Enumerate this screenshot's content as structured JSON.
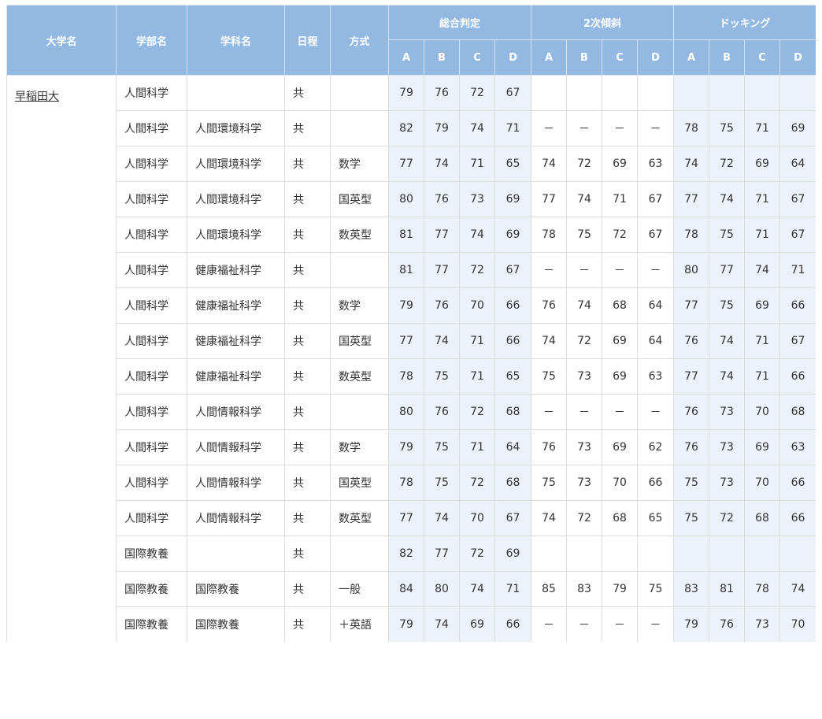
{
  "table": {
    "headers": {
      "university": "大学名",
      "faculty": "学部名",
      "department": "学科名",
      "schedule": "日程",
      "method": "方式",
      "groups": [
        "総合判定",
        "2次傾斜",
        "ドッキング"
      ],
      "grades": [
        "A",
        "B",
        "C",
        "D"
      ]
    },
    "university_name": "早稲田大",
    "rows": [
      {
        "faculty": "人間科学",
        "department": "",
        "schedule": "共",
        "method": "",
        "sogo": [
          "79",
          "76",
          "72",
          "67"
        ],
        "niji": [
          "",
          "",
          "",
          ""
        ],
        "dock": [
          "",
          "",
          "",
          ""
        ]
      },
      {
        "faculty": "人間科学",
        "department": "人間環境科学",
        "schedule": "共",
        "method": "",
        "sogo": [
          "82",
          "79",
          "74",
          "71"
        ],
        "niji": [
          "－",
          "－",
          "－",
          "－"
        ],
        "dock": [
          "78",
          "75",
          "71",
          "69"
        ]
      },
      {
        "faculty": "人間科学",
        "department": "人間環境科学",
        "schedule": "共",
        "method": "数学",
        "sogo": [
          "77",
          "74",
          "71",
          "65"
        ],
        "niji": [
          "74",
          "72",
          "69",
          "63"
        ],
        "dock": [
          "74",
          "72",
          "69",
          "64"
        ]
      },
      {
        "faculty": "人間科学",
        "department": "人間環境科学",
        "schedule": "共",
        "method": "国英型",
        "sogo": [
          "80",
          "76",
          "73",
          "69"
        ],
        "niji": [
          "77",
          "74",
          "71",
          "67"
        ],
        "dock": [
          "77",
          "74",
          "71",
          "67"
        ]
      },
      {
        "faculty": "人間科学",
        "department": "人間環境科学",
        "schedule": "共",
        "method": "数英型",
        "sogo": [
          "81",
          "77",
          "74",
          "69"
        ],
        "niji": [
          "78",
          "75",
          "72",
          "67"
        ],
        "dock": [
          "78",
          "75",
          "71",
          "67"
        ]
      },
      {
        "faculty": "人間科学",
        "department": "健康福祉科学",
        "schedule": "共",
        "method": "",
        "sogo": [
          "81",
          "77",
          "72",
          "67"
        ],
        "niji": [
          "－",
          "－",
          "－",
          "－"
        ],
        "dock": [
          "80",
          "77",
          "74",
          "71"
        ]
      },
      {
        "faculty": "人間科学",
        "department": "健康福祉科学",
        "schedule": "共",
        "method": "数学",
        "sogo": [
          "79",
          "76",
          "70",
          "66"
        ],
        "niji": [
          "76",
          "74",
          "68",
          "64"
        ],
        "dock": [
          "77",
          "75",
          "69",
          "66"
        ]
      },
      {
        "faculty": "人間科学",
        "department": "健康福祉科学",
        "schedule": "共",
        "method": "国英型",
        "sogo": [
          "77",
          "74",
          "71",
          "66"
        ],
        "niji": [
          "74",
          "72",
          "69",
          "64"
        ],
        "dock": [
          "76",
          "74",
          "71",
          "67"
        ]
      },
      {
        "faculty": "人間科学",
        "department": "健康福祉科学",
        "schedule": "共",
        "method": "数英型",
        "sogo": [
          "78",
          "75",
          "71",
          "65"
        ],
        "niji": [
          "75",
          "73",
          "69",
          "63"
        ],
        "dock": [
          "77",
          "74",
          "71",
          "66"
        ]
      },
      {
        "faculty": "人間科学",
        "department": "人間情報科学",
        "schedule": "共",
        "method": "",
        "sogo": [
          "80",
          "76",
          "72",
          "68"
        ],
        "niji": [
          "－",
          "－",
          "－",
          "－"
        ],
        "dock": [
          "76",
          "73",
          "70",
          "68"
        ]
      },
      {
        "faculty": "人間科学",
        "department": "人間情報科学",
        "schedule": "共",
        "method": "数学",
        "sogo": [
          "79",
          "75",
          "71",
          "64"
        ],
        "niji": [
          "76",
          "73",
          "69",
          "62"
        ],
        "dock": [
          "76",
          "73",
          "69",
          "63"
        ]
      },
      {
        "faculty": "人間科学",
        "department": "人間情報科学",
        "schedule": "共",
        "method": "国英型",
        "sogo": [
          "78",
          "75",
          "72",
          "68"
        ],
        "niji": [
          "75",
          "73",
          "70",
          "66"
        ],
        "dock": [
          "75",
          "73",
          "70",
          "66"
        ]
      },
      {
        "faculty": "人間科学",
        "department": "人間情報科学",
        "schedule": "共",
        "method": "数英型",
        "sogo": [
          "77",
          "74",
          "70",
          "67"
        ],
        "niji": [
          "74",
          "72",
          "68",
          "65"
        ],
        "dock": [
          "75",
          "72",
          "68",
          "66"
        ]
      },
      {
        "faculty": "国際教養",
        "department": "",
        "schedule": "共",
        "method": "",
        "sogo": [
          "82",
          "77",
          "72",
          "69"
        ],
        "niji": [
          "",
          "",
          "",
          ""
        ],
        "dock": [
          "",
          "",
          "",
          ""
        ]
      },
      {
        "faculty": "国際教養",
        "department": "国際教養",
        "schedule": "共",
        "method": "一般",
        "sogo": [
          "84",
          "80",
          "74",
          "71"
        ],
        "niji": [
          "85",
          "83",
          "79",
          "75"
        ],
        "dock": [
          "83",
          "81",
          "78",
          "74"
        ]
      },
      {
        "faculty": "国際教養",
        "department": "国際教養",
        "schedule": "共",
        "method": "＋英語",
        "sogo": [
          "79",
          "74",
          "69",
          "66"
        ],
        "niji": [
          "－",
          "－",
          "－",
          "－"
        ],
        "dock": [
          "79",
          "76",
          "73",
          "70"
        ]
      },
      {
        "faculty": "",
        "department": "",
        "schedule": "",
        "method": "",
        "sogo": [
          "",
          "",
          "",
          ""
        ],
        "niji": [
          "",
          "",
          "",
          ""
        ],
        "dock": [
          "",
          "",
          "",
          ""
        ]
      }
    ]
  },
  "colors": {
    "header_bg": "#93b9e3",
    "shade_bg": "#edf2fa",
    "border": "#dcdcdc"
  }
}
